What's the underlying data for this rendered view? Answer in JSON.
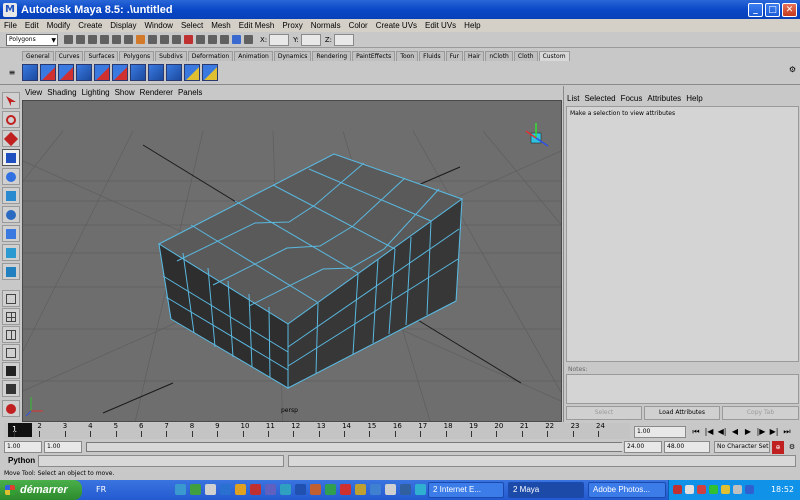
{
  "window": {
    "title": "Autodesk Maya 8.5:  .\\untitled"
  },
  "menus": [
    "File",
    "Edit",
    "Modify",
    "Create",
    "Display",
    "Window",
    "Select",
    "Mesh",
    "Edit Mesh",
    "Proxy",
    "Normals",
    "Color",
    "Create UVs",
    "Edit UVs",
    "Help"
  ],
  "status_line": {
    "mode": "Polygons",
    "x_label": "X:",
    "y_label": "Y:",
    "z_label": "Z:"
  },
  "shelf_tabs": [
    "General",
    "Curves",
    "Surfaces",
    "Polygons",
    "Subdivs",
    "Deformation",
    "Animation",
    "Dynamics",
    "Rendering",
    "PaintEffects",
    "Toon",
    "Fluids",
    "Fur",
    "Hair",
    "nCloth",
    "Cloth",
    "Custom"
  ],
  "shelf_active": "Custom",
  "viewport": {
    "menu": [
      "View",
      "Shading",
      "Lighting",
      "Show",
      "Renderer",
      "Panels"
    ],
    "camera": "persp"
  },
  "attribute_editor": {
    "menu": [
      "List",
      "Selected",
      "Focus",
      "Attributes",
      "Help"
    ],
    "message": "Make a selection to view attributes",
    "notes_label": "Notes:",
    "buttons": {
      "select": "Select",
      "load": "Load Attributes",
      "copy_tab": "Copy Tab"
    }
  },
  "time_slider": {
    "frames": [
      "1",
      "2",
      "3",
      "4",
      "5",
      "6",
      "7",
      "8",
      "9",
      "10",
      "11",
      "12",
      "13",
      "14",
      "15",
      "16",
      "17",
      "18",
      "19",
      "20",
      "21",
      "22",
      "23",
      "24"
    ],
    "current": "1",
    "current_field": "1.00"
  },
  "range_slider": {
    "start": "1.00",
    "playback_start": "1.00",
    "playback_end": "24.00",
    "end": "48.00",
    "character_set": "No Character Set"
  },
  "command_line": {
    "label": "Python"
  },
  "help_line": {
    "text": "Move Tool: Select an object to move."
  },
  "taskbar": {
    "start": "démarrer",
    "language": "FR",
    "tasks": [
      "2 Internet E...",
      "2 Maya",
      "Adobe Photos..."
    ],
    "clock": "18:52"
  }
}
